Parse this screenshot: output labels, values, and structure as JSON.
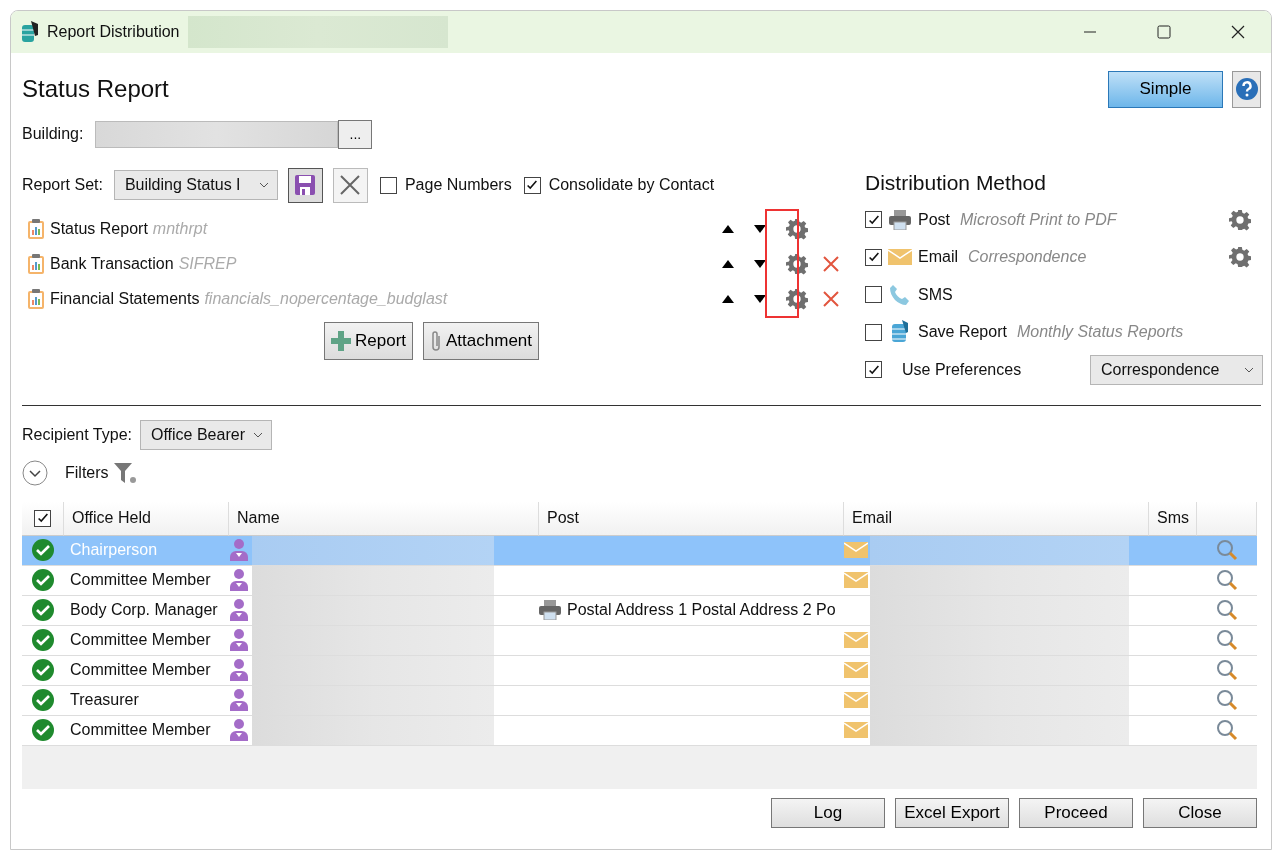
{
  "window": {
    "title": "Report Distribution"
  },
  "heading": "Status Report",
  "view_button": "Simple",
  "building": {
    "label": "Building:",
    "browse_button": "..."
  },
  "report_set": {
    "label": "Report Set:",
    "value": "Building Status I"
  },
  "report_options": [
    {
      "label": "Page Numbers",
      "checked": false
    },
    {
      "label": "Consolidate by Contact",
      "checked": true
    }
  ],
  "reports": [
    {
      "name": "Status Report",
      "code": "mnthrpt",
      "removable": false
    },
    {
      "name": "Bank Transaction",
      "code": "SIFREP",
      "removable": true
    },
    {
      "name": "Financial Statements",
      "code": "financials_nopercentage_budglast",
      "removable": true
    }
  ],
  "report_buttons": [
    {
      "kind": "report",
      "label": "Report"
    },
    {
      "kind": "attachment",
      "label": "Attachment"
    }
  ],
  "distribution": {
    "title": "Distribution Method",
    "methods": [
      {
        "kind": "post",
        "label": "Post",
        "detail": "Microsoft Print to PDF",
        "checked": true,
        "settings": true
      },
      {
        "kind": "email",
        "label": "Email",
        "detail": "Correspondence",
        "checked": true,
        "settings": true
      },
      {
        "kind": "sms",
        "label": "SMS",
        "checked": false,
        "settings": false
      },
      {
        "kind": "save",
        "label": "Save Report",
        "detail": "Monthly Status Reports",
        "checked": false,
        "settings": false
      }
    ],
    "use_preferences": {
      "label": "Use Preferences",
      "checked": true,
      "value": "Correspondence"
    }
  },
  "recipient_type": {
    "label": "Recipient Type:",
    "value": "Office Bearer"
  },
  "filters": {
    "label": "Filters"
  },
  "table": {
    "all_checked": true,
    "columns": [
      "Office Held",
      "Name",
      "Post",
      "Email",
      "Sms"
    ],
    "rows": [
      {
        "office": "Chairperson",
        "selected": true,
        "email": true
      },
      {
        "office": "Committee Member",
        "selected": false,
        "email": true
      },
      {
        "office": "Body Corp. Manager",
        "selected": false,
        "email": false,
        "post": "Postal Address 1 Postal Address 2 Po"
      },
      {
        "office": "Committee Member",
        "selected": false,
        "email": true
      },
      {
        "office": "Committee Member",
        "selected": false,
        "email": true
      },
      {
        "office": "Treasurer",
        "selected": false,
        "email": true
      },
      {
        "office": "Committee Member",
        "selected": false,
        "email": true
      }
    ]
  },
  "buttons": [
    "Log",
    "Excel Export",
    "Proceed",
    "Close"
  ]
}
